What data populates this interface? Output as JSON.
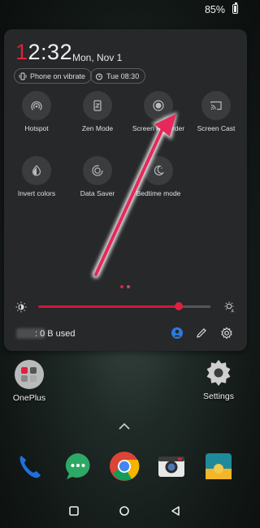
{
  "status_bar": {
    "battery": "85%"
  },
  "quick_settings": {
    "time_first_digit": "1",
    "time_rest": "2:32",
    "date": "Mon, Nov 1",
    "chips": [
      {
        "label": "Phone on vibrate",
        "icon": "vibrate-icon"
      },
      {
        "label": "Tue 08:30",
        "icon": "alarm-icon"
      }
    ],
    "tiles": [
      {
        "label": "Hotspot",
        "icon": "hotspot-icon"
      },
      {
        "label": "Zen Mode",
        "icon": "zen-mode-icon"
      },
      {
        "label": "Screen Recorder",
        "icon": "screen-recorder-icon"
      },
      {
        "label": "Screen Cast",
        "icon": "screen-cast-icon"
      },
      {
        "label": "Invert colors",
        "icon": "invert-colors-icon"
      },
      {
        "label": "Data Saver",
        "icon": "data-saver-icon"
      },
      {
        "label": "Bedtime mode",
        "icon": "bedtime-mode-icon"
      }
    ],
    "page_indicator": {
      "pages": 2,
      "current": 1
    },
    "brightness": {
      "level": 0.84
    },
    "data_used": ": 0 B used"
  },
  "home_screen": {
    "apps": [
      {
        "label": "OnePlus",
        "icon": "oneplus-folder-icon"
      },
      {
        "label": "Settings",
        "icon": "settings-gear-icon"
      }
    ],
    "dock": [
      "phone-icon",
      "messages-icon",
      "chrome-icon",
      "camera-icon",
      "gallery-icon"
    ]
  },
  "colors": {
    "accent": "#e0203e",
    "panel": "#26282a",
    "arrow": "#e8285a"
  }
}
